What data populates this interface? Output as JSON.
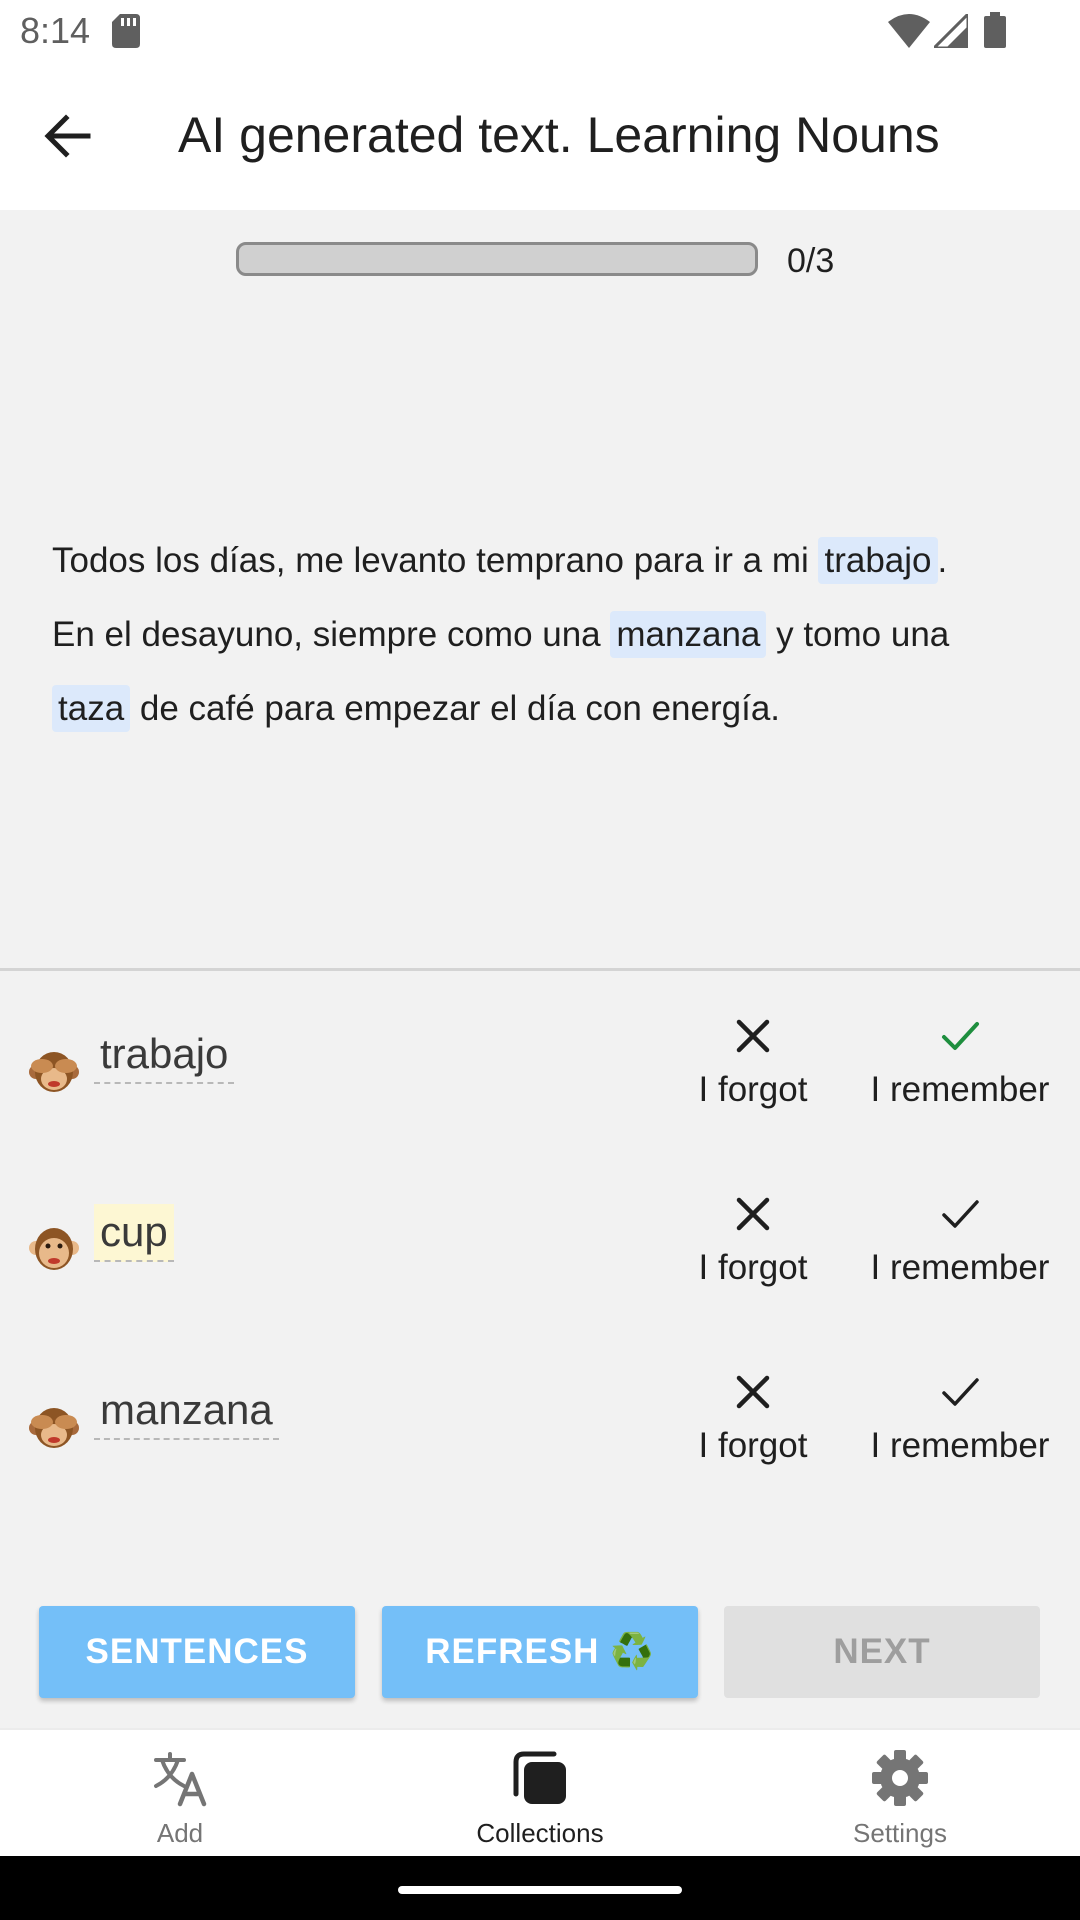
{
  "status_bar": {
    "time": "8:14"
  },
  "app_bar": {
    "title": "AI generated text. Learning Nouns"
  },
  "progress": {
    "text": "0/3",
    "fraction": 0
  },
  "passage": {
    "segments": [
      "Todos los días, me levanto temprano para ir a mi ",
      "trabajo",
      ".",
      "En el desayuno, siempre como una ",
      "manzana",
      " y tomo una ",
      "taza",
      " de café para empezar el día con energía."
    ]
  },
  "words": [
    {
      "text": "trabajo",
      "icon": "see-no-evil-monkey",
      "revealed": false,
      "forgot_label": "I forgot",
      "remember_label": "I remember",
      "remember_color": "#1e8e3e"
    },
    {
      "text": "cup",
      "icon": "monkey-face",
      "revealed": true,
      "forgot_label": "I forgot",
      "remember_label": "I remember",
      "remember_color": "#1f1f1f"
    },
    {
      "text": "manzana",
      "icon": "see-no-evil-monkey",
      "revealed": false,
      "forgot_label": "I forgot",
      "remember_label": "I remember",
      "remember_color": "#1f1f1f"
    }
  ],
  "actions": {
    "sentences_label": "SENTENCES",
    "refresh_label": "REFRESH ♻️",
    "next_label": "NEXT"
  },
  "bottom_nav": {
    "add_label": "Add",
    "collections_label": "Collections",
    "settings_label": "Settings",
    "active": "collections"
  },
  "colors": {
    "primary_button": "#74bff8",
    "highlight": "#dce9fb",
    "revealed_word": "#fdf7d3"
  }
}
